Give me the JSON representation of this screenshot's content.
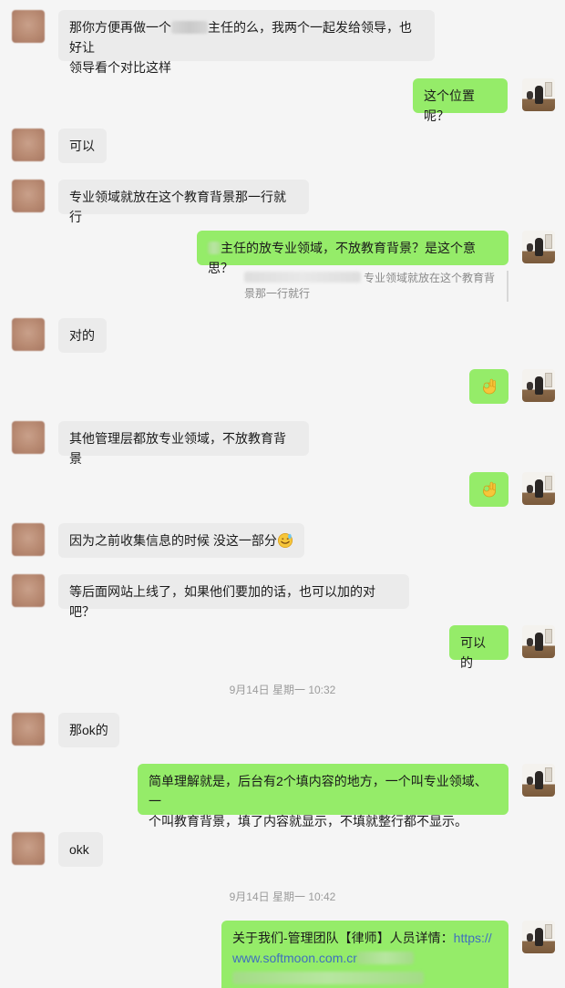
{
  "messages": {
    "m1_before": "那你方便再做一个",
    "m1_after": "主任的么，我两个一起发给领导，也好让",
    "m1_line2": "领导看个对比这样",
    "m2": "这个位置呢？",
    "m3": "可以",
    "m4": "专业领域就放在这个教育背景那一行就行",
    "m5": "主任的放专业领域，不放教育背景？是这个意思？",
    "m5_quote_a": "专业领域就放在这个教育背",
    "m5_quote_b": "景那一行就行",
    "m6": "对的",
    "m7_emoji": "ok-hand-emoji",
    "m8": "其他管理层都放专业领域，不放教育背景",
    "m9_emoji": "ok-hand-emoji",
    "m10": "因为之前收集信息的时候 没这一部分",
    "m10_emoji": "sweat-smile-emoji",
    "m11": "等后面网站上线了，如果他们要加的话，也可以加的对吧？",
    "m12": "可以的",
    "ts1": "9月14日 星期一 10:32",
    "m13": "那ok的",
    "m14_line1": "简单理解就是，后台有2个填内容的地方，一个叫专业领域、一",
    "m14_line2": "个叫教育背景，填了内容就显示，不填就整行都不显示。",
    "m15": "okk",
    "ts2": "9月14日 星期一 10:42",
    "m16_line1": "关于我们-管理团队【律师】人员详情：",
    "m16_link1": "https://",
    "m16_link2": "www.softmoon.com.cr"
  },
  "colors": {
    "background": "#f5f5f5",
    "incoming_bubble": "#ebebeb",
    "outgoing_bubble": "#95ec69",
    "timestamp_text": "#9b9b9b",
    "link": "#3f6fbf"
  }
}
